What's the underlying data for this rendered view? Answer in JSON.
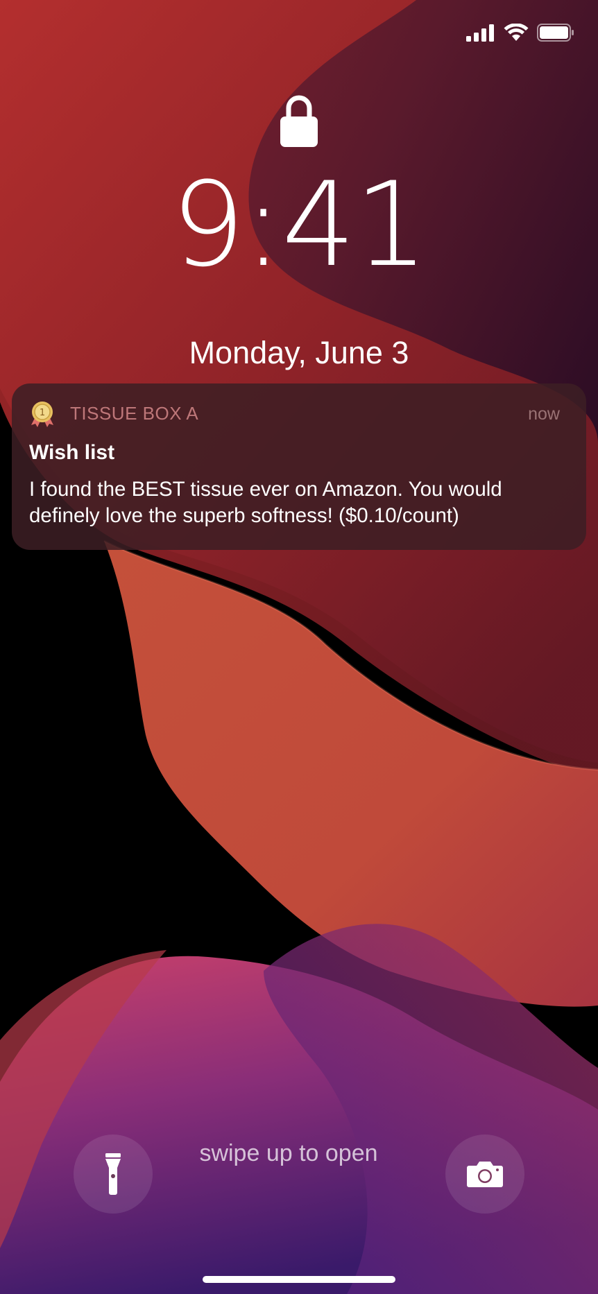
{
  "status_bar": {
    "signal_icon": "cellular-signal-icon",
    "wifi_icon": "wifi-icon",
    "battery_icon": "battery-icon"
  },
  "lock_screen": {
    "lock_icon": "lock-icon",
    "time": "9:41",
    "date": "Monday, June 3"
  },
  "notification": {
    "app_icon": "award-medal-icon",
    "app_name": "TISSUE BOX A",
    "time": "now",
    "title": "Wish list",
    "body": "I found the BEST tissue ever on Amazon. You would definely love the superb softness! ($0.10/count)"
  },
  "bottom": {
    "flashlight_icon": "flashlight-icon",
    "swipe_text": "swipe up to open",
    "camera_icon": "camera-icon"
  },
  "colors": {
    "notification_bg": "#3c1e24",
    "app_name_color": "#e69696",
    "wallpaper_red": "#a8282c",
    "wallpaper_orange": "#c8503a",
    "wallpaper_purple": "#5a2a78"
  }
}
